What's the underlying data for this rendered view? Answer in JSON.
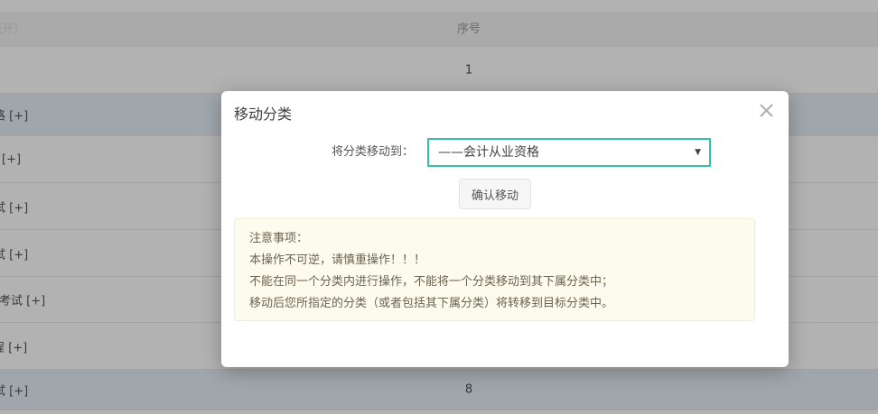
{
  "table": {
    "header": {
      "category_column_fragment": "展开)",
      "serial_column": "序号"
    },
    "rows": [
      {
        "name": "",
        "serial": "1",
        "selected": false
      },
      {
        "name": "格 [+]",
        "serial": "",
        "selected": true
      },
      {
        "name": "[+]",
        "serial": "",
        "selected": false
      },
      {
        "name": "试 [+]",
        "serial": "",
        "selected": false
      },
      {
        "name": "试 [+]",
        "serial": "",
        "selected": false
      },
      {
        "name": "考试 [+]",
        "serial": "",
        "selected": false
      },
      {
        "name": "程 [+]",
        "serial": "",
        "selected": false
      },
      {
        "name": "试 [+]",
        "serial": "8",
        "selected": true
      }
    ],
    "colors": {
      "header_bg": "#f4f4f4",
      "selected_row_bg": "#e5eff7"
    }
  },
  "overlay": {
    "color": "rgba(0,0,0,0.30)"
  },
  "modal": {
    "title": "移动分类",
    "close_icon": "close-x-icon",
    "form": {
      "label": "将分类移动到：",
      "select_value": "——会计从业资格",
      "dropdown_arrow": "▼",
      "confirm_button": "确认移动",
      "select_border_color": "#35bfa7"
    },
    "notice": {
      "bg_color": "#fdfaee",
      "lines": [
        "注意事项：",
        "本操作不可逆，请慎重操作！！！",
        "不能在同一个分类内进行操作，不能将一个分类移动到其下属分类中；",
        "移动后您所指定的分类（或者包括其下属分类）将转移到目标分类中。"
      ]
    }
  }
}
